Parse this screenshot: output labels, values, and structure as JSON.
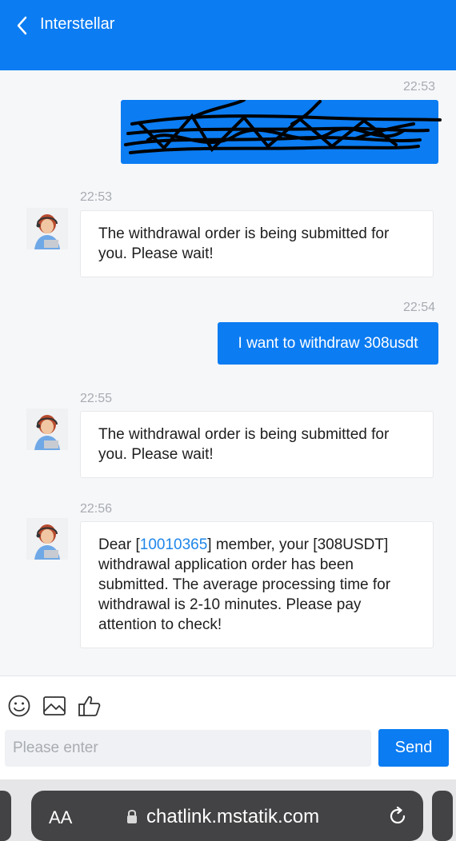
{
  "header": {
    "title": "Interstellar"
  },
  "messages": [
    {
      "side": "out",
      "time": "22:53",
      "content": "",
      "scribbled": true
    },
    {
      "side": "in",
      "time": "22:53",
      "text": "The withdrawal order is being submitted for you. Please wait!"
    },
    {
      "side": "out",
      "time": "22:54",
      "text": "I want to withdraw 308usdt"
    },
    {
      "side": "in",
      "time": "22:55",
      "text": "The withdrawal order is being submitted for you. Please wait!"
    },
    {
      "side": "in",
      "time": "22:56",
      "text_pre": "Dear [",
      "member_id": "10010365",
      "text_post": "] member, your [308USDT] withdrawal application order has been submitted. The average processing time for withdrawal is 2-10 minutes. Please pay attention to check!"
    }
  ],
  "toolbar": {
    "icons": [
      "emoji-icon",
      "image-icon",
      "thumbs-up-icon"
    ],
    "input_placeholder": "Please enter",
    "input_value": "",
    "send_label": "Send"
  },
  "browser": {
    "text_size_label": "AA",
    "url": "chatlink.mstatik.com"
  },
  "colors": {
    "accent": "#0b7cf2",
    "link": "#1f86ea",
    "background": "#f6f7f9"
  }
}
